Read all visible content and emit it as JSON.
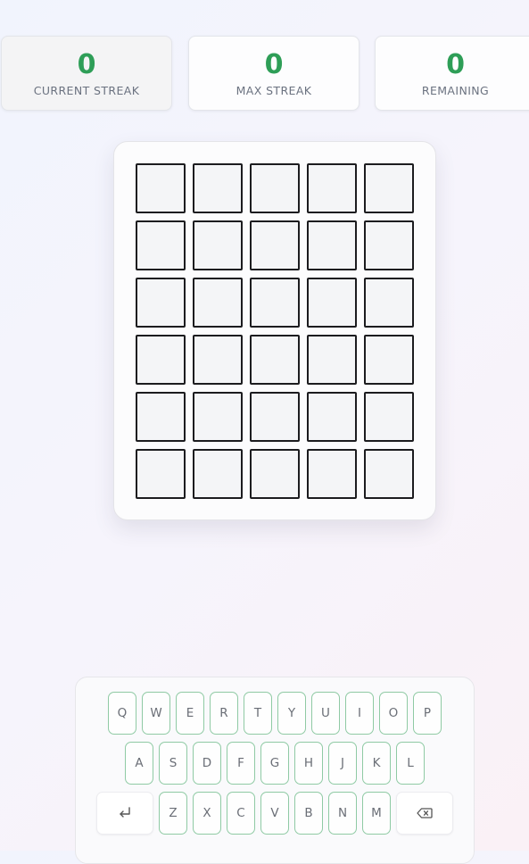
{
  "stats": [
    {
      "value": "0",
      "label": "CURRENT STREAK"
    },
    {
      "value": "0",
      "label": "MAX STREAK"
    },
    {
      "value": "0",
      "label": "REMAINING"
    }
  ],
  "board": {
    "rows": [
      [
        "",
        "",
        "",
        "",
        ""
      ],
      [
        "",
        "",
        "",
        "",
        ""
      ],
      [
        "",
        "",
        "",
        "",
        ""
      ],
      [
        "",
        "",
        "",
        "",
        ""
      ],
      [
        "",
        "",
        "",
        "",
        ""
      ],
      [
        "",
        "",
        "",
        "",
        ""
      ]
    ]
  },
  "keyboard": {
    "row1": [
      "Q",
      "W",
      "E",
      "R",
      "T",
      "Y",
      "U",
      "I",
      "O",
      "P"
    ],
    "row2": [
      "A",
      "S",
      "D",
      "F",
      "G",
      "H",
      "J",
      "K",
      "L"
    ],
    "row3": [
      "Z",
      "X",
      "C",
      "V",
      "B",
      "N",
      "M"
    ],
    "enter_icon": "enter-icon",
    "backspace_icon": "backspace-icon"
  },
  "colors": {
    "accent_green": "#2e9e57",
    "key_border": "#8fcaa4",
    "tile_border": "#1c1c1f"
  }
}
